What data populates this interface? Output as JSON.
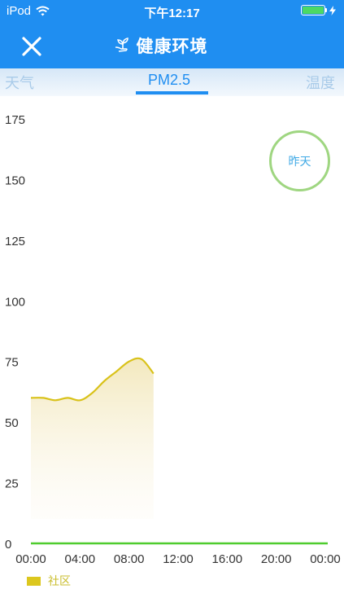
{
  "status_bar": {
    "carrier": "iPod",
    "time": "下午12:17"
  },
  "nav": {
    "title": "健康环境"
  },
  "tabs": [
    "天气",
    "PM2.5",
    "温度"
  ],
  "active_tab": "PM2.5",
  "yesterday_button": "昨天",
  "legend": {
    "label": "社区"
  },
  "colors": {
    "primary": "#1f8ef1",
    "series_line": "#d9c21a",
    "axis_line": "#4ecc2e",
    "ring": "#9fd681"
  },
  "chart_data": {
    "type": "area",
    "x_ticks": [
      "00:00",
      "04:00",
      "08:00",
      "12:00",
      "16:00",
      "20:00",
      "00:00"
    ],
    "y_ticks": [
      0,
      25,
      50,
      75,
      100,
      125,
      150,
      175
    ],
    "ylim": [
      0,
      175
    ],
    "xlim_hours": [
      0,
      24
    ],
    "series": [
      {
        "name": "社区",
        "x_hours": [
          0,
          1,
          2,
          3,
          4,
          5,
          6,
          7,
          8,
          9,
          10
        ],
        "values": [
          60,
          60,
          59,
          60,
          59,
          62,
          67,
          71,
          75,
          76,
          70
        ]
      }
    ]
  }
}
